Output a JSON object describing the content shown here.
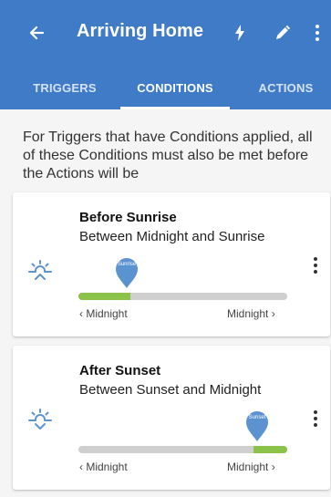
{
  "header": {
    "title": "Arriving Home",
    "icons": [
      "back-arrow-icon",
      "flash-icon",
      "pencil-icon",
      "more-vert-icon"
    ]
  },
  "tabs": [
    {
      "label": "TRIGGERS",
      "active": false
    },
    {
      "label": "CONDITIONS",
      "active": true
    },
    {
      "label": "ACTIONS",
      "active": false
    }
  ],
  "intro_text": "For Triggers that have Conditions applied, all of these Conditions must also be met before the Actions will be",
  "conditions": [
    {
      "title": "Before Sunrise",
      "subtitle": "Between Midnight and Sunrise",
      "marker_label": "Sunrise",
      "range_start": 0.0,
      "range_end": 0.25,
      "left_label": "‹ Midnight",
      "right_label": "Midnight ›",
      "icon": "sunrise-icon"
    },
    {
      "title": "After Sunset",
      "subtitle": "Between Sunset and Midnight",
      "marker_label": "Sunset",
      "range_start": 0.84,
      "range_end": 1.0,
      "left_label": "‹ Midnight",
      "right_label": "Midnight ›",
      "icon": "sunset-icon"
    }
  ],
  "colors": {
    "appbar": "#3f7bc7",
    "accent": "#5b93d1",
    "progress": "#8bc34a",
    "track": "#cfcfcf"
  }
}
